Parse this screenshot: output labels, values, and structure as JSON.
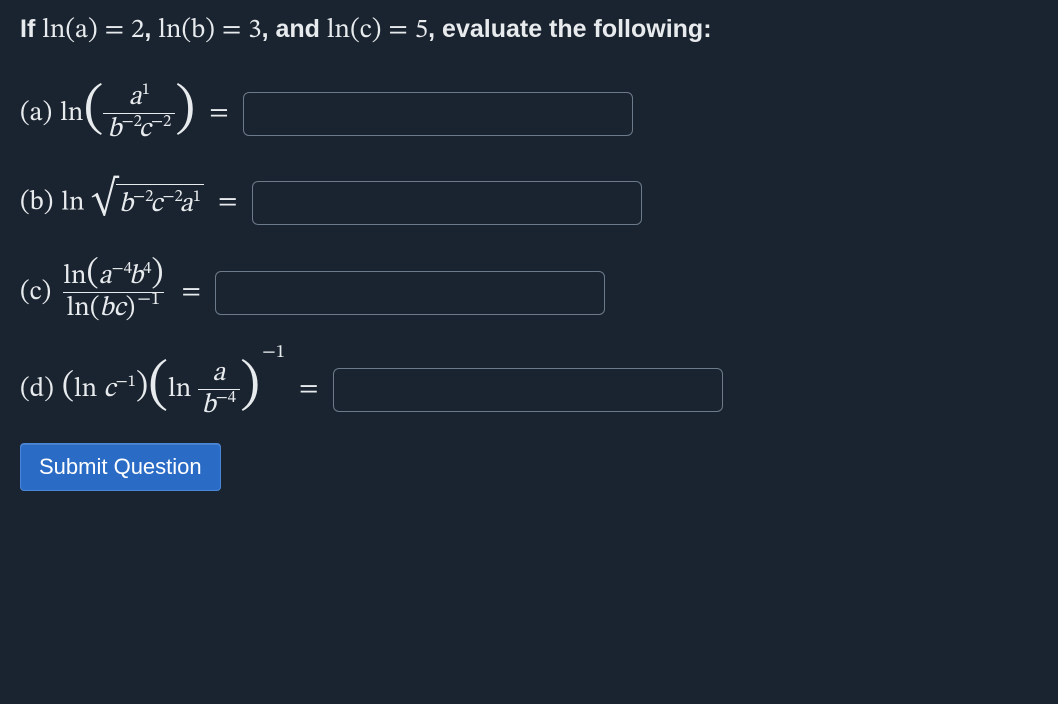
{
  "given": {
    "lna": 2,
    "lnb": 3,
    "lnc": 5
  },
  "prompt": {
    "prefix": "If ",
    "eq1_lhs": "ln(a)",
    "eq1_rhs": "2",
    "eq2_lhs": "ln(b)",
    "eq2_rhs": "3",
    "eq3_lhs": "ln(c)",
    "eq3_rhs": "5",
    "suffix": ", evaluate the following:",
    "eqsign": "=",
    "sep": ", ",
    "and": ", and "
  },
  "parts": {
    "a": {
      "label": "(a)",
      "fn": "ln",
      "num_base": "a",
      "num_exp": "1",
      "den_b": "b",
      "den_b_exp": "−2",
      "den_c": "c",
      "den_c_exp": "−2"
    },
    "b": {
      "label": "(b)",
      "fn": "ln",
      "rad_b": "b",
      "rad_b_exp": "−2",
      "rad_c": "c",
      "rad_c_exp": "−2",
      "rad_a": "a",
      "rad_a_exp": "1"
    },
    "c": {
      "label": "(c)",
      "num_fn": "ln",
      "num_a": "a",
      "num_a_exp": "−4",
      "num_b": "b",
      "num_b_exp": "4",
      "den_fn": "ln",
      "den_arg": "bc",
      "den_outer_exp": "−1"
    },
    "d": {
      "label": "(d)",
      "f1_fn": "ln",
      "f1_c": "c",
      "f1_c_exp": "−1",
      "f2_fn": "ln",
      "f2_num": "a",
      "f2_den_b": "b",
      "f2_den_b_exp": "−4",
      "outer_exp": "−1"
    }
  },
  "equals": "=",
  "answers": {
    "a": "",
    "b": "",
    "c": "",
    "d": ""
  },
  "submit_label": "Submit Question"
}
